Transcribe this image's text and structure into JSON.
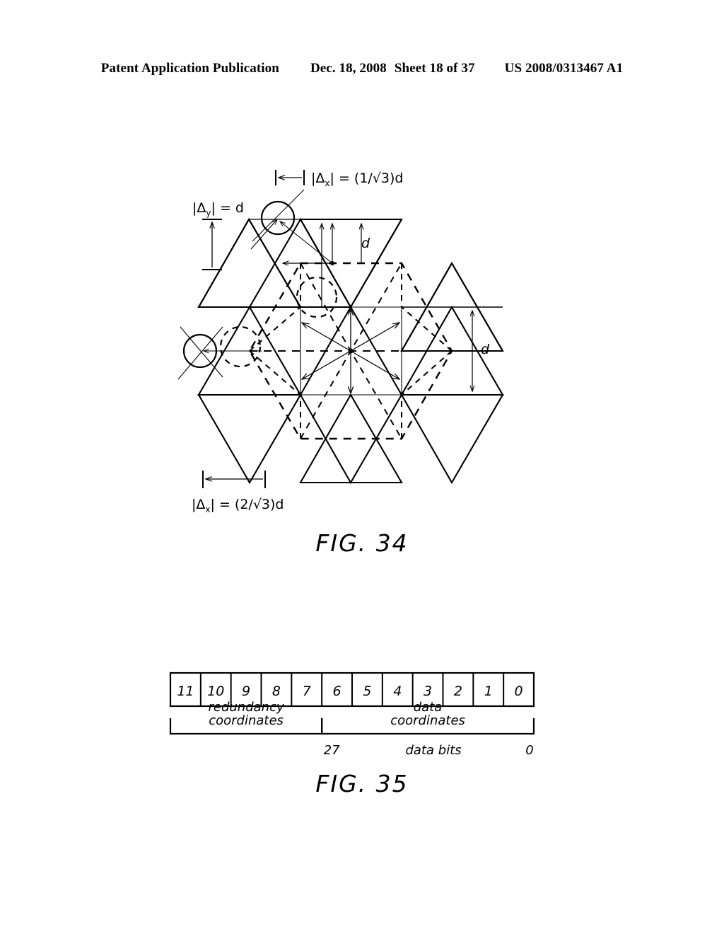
{
  "header": {
    "publication": "Patent Application Publication",
    "date": "Dec. 18, 2008",
    "sheet": "Sheet 18 of 37",
    "patent_number": "US 2008/0313467 A1"
  },
  "figures": [
    {
      "id": "fig34",
      "caption": "FIG. 34",
      "type": "geometric-tessellation-diagram",
      "labels": {
        "delta_x_top": "|Δx| = (1/√3)d",
        "delta_x_top_main": "|Δ",
        "delta_x_top_sub": "x",
        "delta_x_top_rest": "| = (1/√3)d",
        "delta_y_left_main": "|Δ",
        "delta_y_left_sub": "y",
        "delta_y_left_rest": "| = d",
        "delta_x_bottom_main": "|Δ",
        "delta_x_bottom_sub": "x",
        "delta_x_bottom_rest": "| = (2/√3)d",
        "d_top": "d",
        "d_right": "d"
      }
    },
    {
      "id": "fig35",
      "caption": "FIG. 35",
      "type": "bit-field-table",
      "cells": [
        "11",
        "10",
        "9",
        "8",
        "7",
        "6",
        "5",
        "4",
        "3",
        "2",
        "1",
        "0"
      ],
      "groups": [
        {
          "label_line1": "redundancy",
          "label_line2": "coordinates"
        },
        {
          "label_line1": "data",
          "label_line2": "coordinates"
        }
      ],
      "footer": {
        "left_value": "27",
        "center_label": "data bits",
        "right_value": "0"
      }
    }
  ],
  "colors": {
    "ink": "#000000",
    "page": "#ffffff"
  }
}
